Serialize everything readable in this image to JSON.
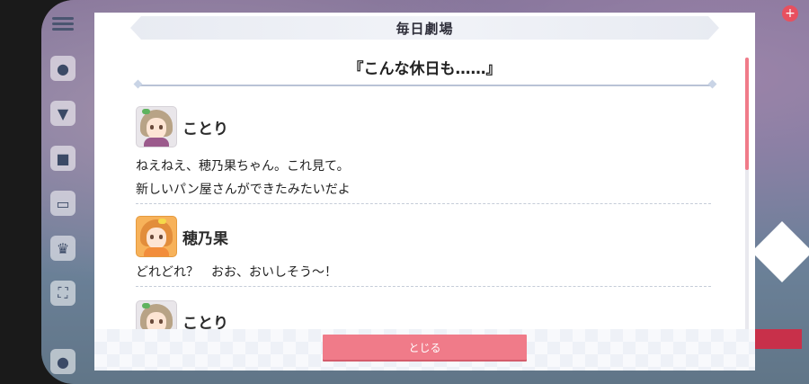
{
  "dialog": {
    "title": "毎日劇場",
    "story_title": "『こんな休日も……』",
    "close_label": "とじる",
    "scroll_progress": 0.0,
    "accent_color": "#f07b89"
  },
  "entries": [
    {
      "speaker": "ことり",
      "avatar": "kotori-avatar",
      "lines": [
        "ねえねえ、穂乃果ちゃん。これ見て。",
        "新しいパン屋さんができたみたいだよ"
      ]
    },
    {
      "speaker": "穂乃果",
      "avatar": "honoka-avatar",
      "lines": [
        "どれどれ？　おお、おいしそう～！"
      ]
    },
    {
      "speaker": "ことり",
      "avatar": "kotori-avatar",
      "lines": []
    }
  ],
  "sidebar": {
    "icons": [
      "menu-icon",
      "chat-icon",
      "shirt-icon",
      "gift-icon",
      "screen-icon",
      "trophy-icon",
      "fullscreen-icon",
      "person-icon"
    ]
  }
}
